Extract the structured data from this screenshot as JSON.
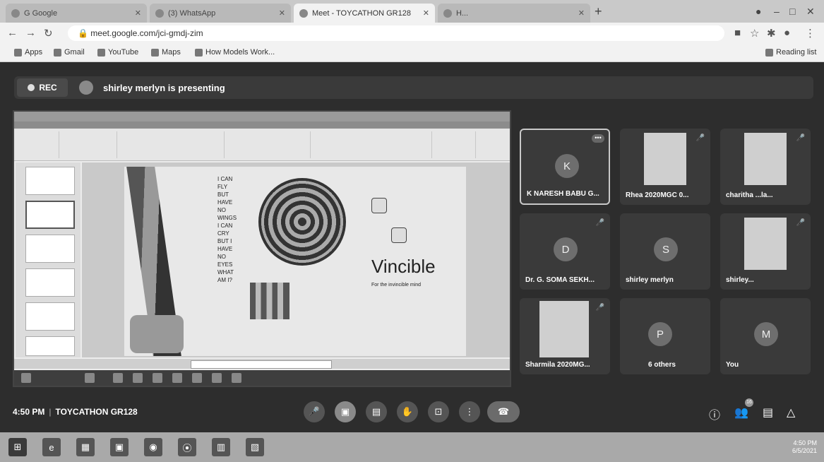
{
  "browser": {
    "tabs": [
      {
        "title": "G Google",
        "active": false
      },
      {
        "title": "(3) WhatsApp",
        "active": false
      },
      {
        "title": "Meet - TOYCATHON GR128",
        "active": true
      },
      {
        "title": "H...",
        "active": false
      }
    ],
    "url": "meet.google.com/jci-gmdj-zim",
    "bookmarks": [
      "Apps",
      "Gmail",
      "YouTube",
      "Maps",
      "How Models Work..."
    ],
    "reading_list": "Reading list"
  },
  "meet": {
    "rec_label": "REC",
    "presenting_text": "shirley merlyn is presenting",
    "time": "4:50 PM",
    "meeting_name": "TOYCATHON GR128",
    "participant_badge": "16"
  },
  "slide": {
    "stack_lines": [
      "I CAN",
      "FLY",
      "BUT",
      "HAVE",
      "NO",
      "WINGS",
      "I CAN",
      "CRY",
      "BUT I",
      "HAVE",
      "NO",
      "EYES",
      "WHAT",
      "AM I?"
    ],
    "title": "Vincible",
    "tagline": "For the invincible mind"
  },
  "participants": [
    {
      "name": "K NARESH BABU G...",
      "initial": "K",
      "video": false,
      "pinned": true
    },
    {
      "name": "Rhea 2020MGC 0...",
      "initial": "",
      "video": true
    },
    {
      "name": "charitha ...la...",
      "initial": "",
      "video": true
    },
    {
      "name": "Dr. G. SOMA SEKH...",
      "initial": "D",
      "video": false
    },
    {
      "name": "shirley merlyn",
      "initial": "S",
      "video": false
    },
    {
      "name": "shirley...",
      "initial": "",
      "video": true
    },
    {
      "name": "Sharmila 2020MG...",
      "initial": "",
      "video": true
    },
    {
      "name": "6 others",
      "initial": "P",
      "video": false
    },
    {
      "name": "You",
      "initial": "M",
      "video": false
    }
  ],
  "taskbar": {
    "clock_time": "4:50 PM",
    "clock_date": "6/5/2021"
  },
  "colors": {
    "meet_bg": "#2d2d2d",
    "tile_bg": "#3a3a3a"
  }
}
